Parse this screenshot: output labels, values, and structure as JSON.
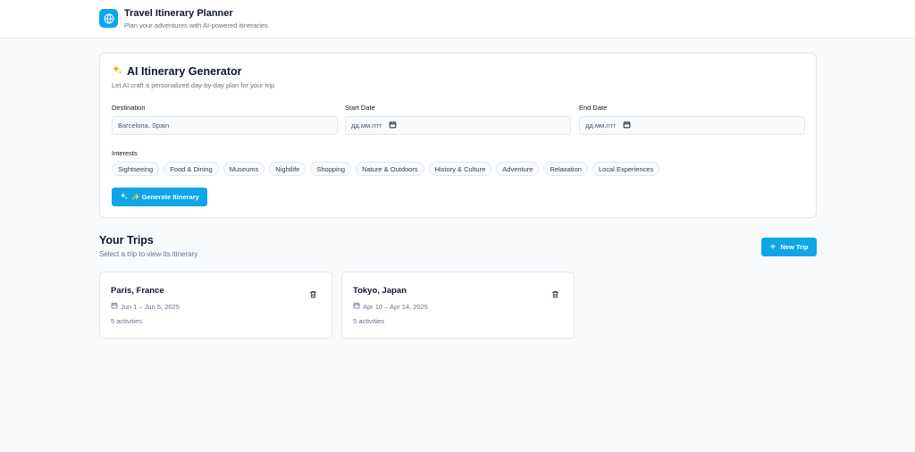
{
  "header": {
    "title": "Travel Itinerary Planner",
    "subtitle": "Plan your adventures with AI-powered itineraries"
  },
  "generator": {
    "title": "AI Itinerary Generator",
    "subtitle": "Let AI craft a personalized day-by-day plan for your trip",
    "destination_label": "Destination",
    "destination_value": "Barcelona, Spain",
    "start_label": "Start Date",
    "start_value": "дд.мм.гггг",
    "end_label": "End Date",
    "end_value": "дд.мм.гггг",
    "interests_label": "Interests",
    "interests": [
      "Sightseeing",
      "Food & Dining",
      "Museums",
      "Nightlife",
      "Shopping",
      "Nature & Outdoors",
      "History & Culture",
      "Adventure",
      "Relaxation",
      "Local Experiences"
    ],
    "button_label": "✨ Generate Itinerary"
  },
  "trips": {
    "title": "Your Trips",
    "subtitle": "Select a trip to view its itinerary",
    "new_trip_label": "New Trip",
    "items": [
      {
        "name": "Paris, France",
        "dates": "Jun 1 – Jun 5, 2025",
        "activities": "5 activities"
      },
      {
        "name": "Tokyo, Japan",
        "dates": "Apr 10 – Apr 14, 2025",
        "activities": "5 activities"
      }
    ]
  },
  "icons": {
    "logo": "globe-icon",
    "generator": "sparkles-icon",
    "date_picker": "calendar-icon",
    "new_trip": "plus-icon",
    "delete": "trash-icon"
  },
  "colors": {
    "accent": "#0ea5e9",
    "background": "#f8fafc"
  }
}
